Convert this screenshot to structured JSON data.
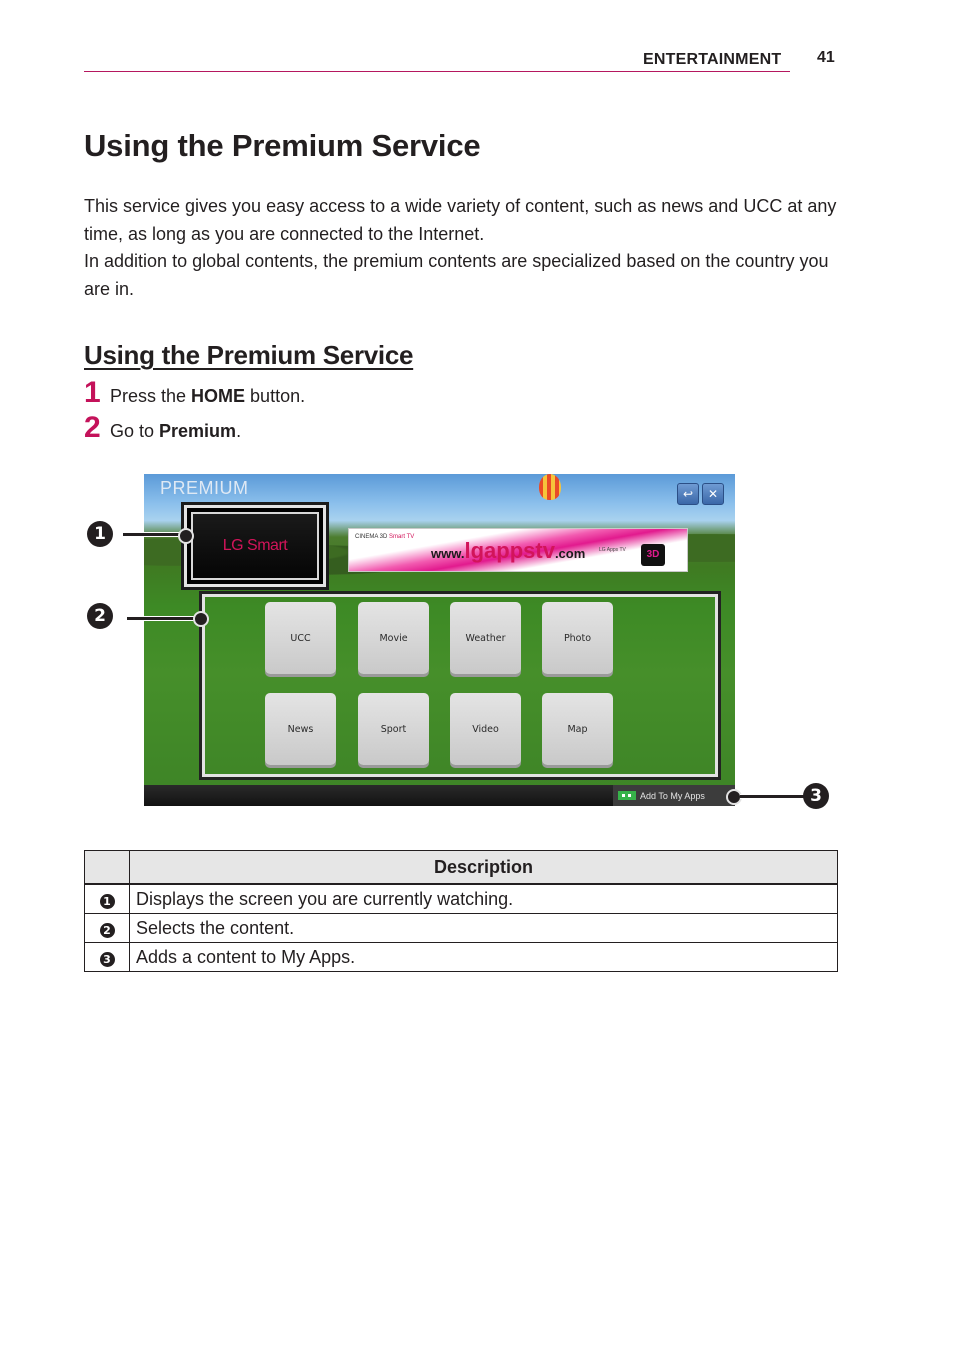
{
  "header": {
    "section": "ENTERTAINMENT",
    "page_number": "41",
    "rule_color": "#b5175f"
  },
  "title": "Using the Premium Service",
  "intro": [
    "This service gives you easy access to a wide variety of content, such as news and UCC at any time, as long as you are connected to the Internet.",
    "In addition to global contents, the premium contents are specialized based on the country you are in."
  ],
  "subsection": {
    "title": "Using the Premium Service",
    "steps": [
      {
        "number": "1",
        "pre": "Press the ",
        "bold": "HOME",
        "post": " button."
      },
      {
        "number": "2",
        "pre": "Go to ",
        "bold": "Premium",
        "post": "."
      }
    ],
    "accent_color": "#c4125a"
  },
  "tv_screen": {
    "title": "PREMIUM",
    "back_icon": "↩",
    "close_icon": "✕",
    "now_watching_label": "LG Smart",
    "banner": {
      "brand_line": "CINEMA 3D",
      "brand_smart": "Smart TV",
      "url_prefix": "www.",
      "url_main": "lgappstv",
      "url_suffix": ".com",
      "lg_apps": "LG Apps TV",
      "icon_3d": "3D"
    },
    "tiles": [
      "UCC",
      "Movie",
      "Weather",
      "Photo",
      "News",
      "Sport",
      "Video",
      "Map"
    ],
    "add_to_my_apps": "Add To My Apps"
  },
  "callouts": [
    "1",
    "2",
    "3"
  ],
  "table": {
    "header": [
      "",
      "Description"
    ],
    "rows": [
      {
        "num": "1",
        "text": "Displays the screen you are currently watching."
      },
      {
        "num": "2",
        "text": "Selects the content."
      },
      {
        "num": "3",
        "text": "Adds a content to My Apps."
      }
    ]
  }
}
